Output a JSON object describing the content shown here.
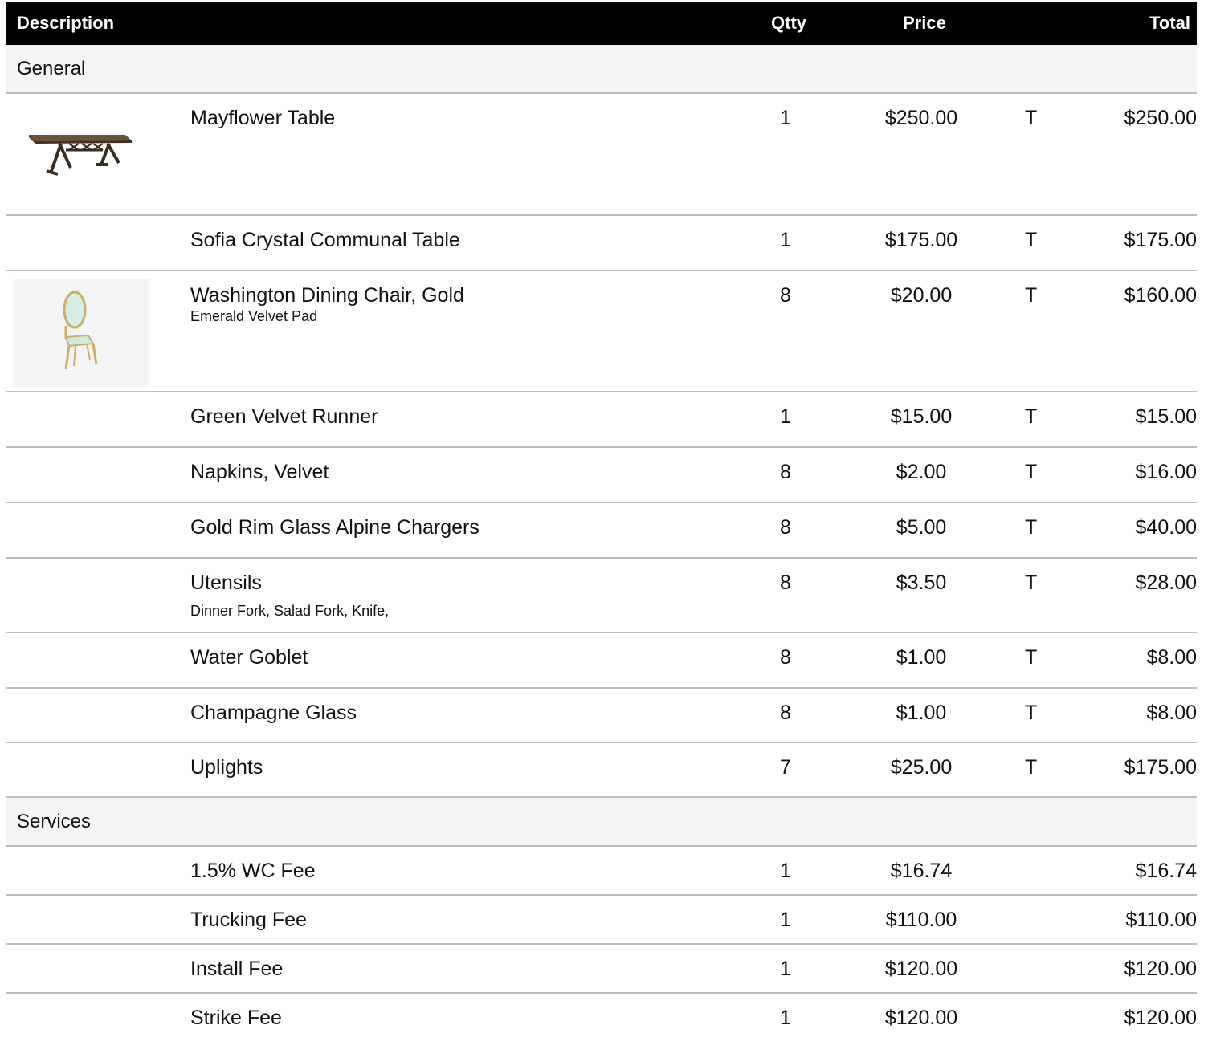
{
  "header": {
    "description": "Description",
    "qty": "Qtty",
    "price": "Price",
    "total": "Total"
  },
  "sections": {
    "general": "General",
    "services": "Services"
  },
  "general_items": [
    {
      "name": "Mayflower Table",
      "sub": "",
      "qty": "1",
      "price": "$250.00",
      "tax": "T",
      "total": "$250.00",
      "image": "table"
    },
    {
      "name": "Sofia Crystal Communal Table",
      "sub": "",
      "qty": "1",
      "price": "$175.00",
      "tax": "T",
      "total": "$175.00"
    },
    {
      "name": "Washington Dining Chair, Gold",
      "sub": "Emerald Velvet Pad",
      "qty": "8",
      "price": "$20.00",
      "tax": "T",
      "total": "$160.00",
      "image": "chair"
    },
    {
      "name": "Green Velvet Runner",
      "sub": "",
      "qty": "1",
      "price": "$15.00",
      "tax": "T",
      "total": "$15.00"
    },
    {
      "name": "Napkins, Velvet",
      "sub": "",
      "qty": "8",
      "price": "$2.00",
      "tax": "T",
      "total": "$16.00"
    },
    {
      "name": "Gold Rim Glass Alpine Chargers",
      "sub": "",
      "qty": "8",
      "price": "$5.00",
      "tax": "T",
      "total": "$40.00"
    },
    {
      "name": "Utensils",
      "sub": "Dinner Fork, Salad Fork, Knife,",
      "qty": "8",
      "price": "$3.50",
      "tax": "T",
      "total": "$28.00"
    },
    {
      "name": "Water Goblet",
      "sub": "",
      "qty": "8",
      "price": "$1.00",
      "tax": "T",
      "total": "$8.00"
    },
    {
      "name": "Champagne Glass",
      "sub": "",
      "qty": "8",
      "price": "$1.00",
      "tax": "T",
      "total": "$8.00"
    },
    {
      "name": "Uplights",
      "sub": "",
      "qty": "7",
      "price": "$25.00",
      "tax": "T",
      "total": "$175.00"
    }
  ],
  "service_items": [
    {
      "name": "1.5% WC Fee",
      "qty": "1",
      "price": "$16.74",
      "tax": "",
      "total": "$16.74"
    },
    {
      "name": "Trucking Fee",
      "qty": "1",
      "price": "$110.00",
      "tax": "",
      "total": "$110.00"
    },
    {
      "name": "Install Fee",
      "qty": "1",
      "price": "$120.00",
      "tax": "",
      "total": "$120.00"
    },
    {
      "name": "Strike Fee",
      "qty": "1",
      "price": "$120.00",
      "tax": "",
      "total": "$120.00"
    }
  ],
  "colors": {
    "header_bg": "#000000",
    "section_bg": "#f5f5f5",
    "divider": "#bdbdbd"
  }
}
